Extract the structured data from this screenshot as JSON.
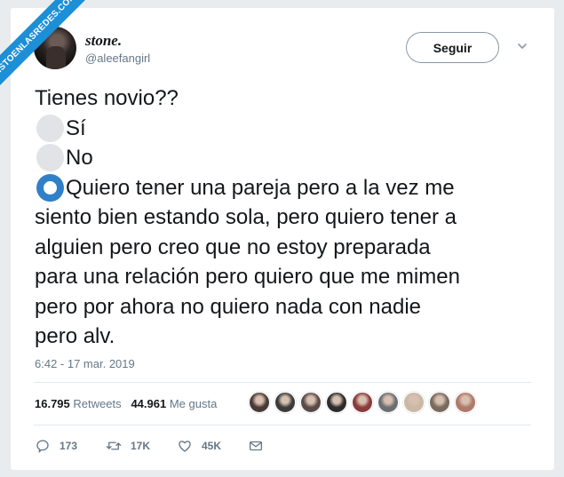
{
  "watermark": {
    "text": "VISTOENLASREDES.COM"
  },
  "tweet": {
    "display_name": "stone.",
    "handle": "@aleefangirl",
    "follow_label": "Seguir",
    "question": "Tienes novio??",
    "options": [
      {
        "label": "Sí",
        "selected": false
      },
      {
        "label": "No",
        "selected": false
      }
    ],
    "selected_option_lines": [
      "Quiero tener una pareja pero a la vez me",
      "siento bien estando sola, pero quiero tener a",
      "alguien pero creo que no estoy preparada",
      "para una relación pero quiero que me mimen",
      "pero por ahora no quiero nada con nadie",
      "pero alv."
    ],
    "timestamp": "6:42 - 17 mar. 2019"
  },
  "stats": {
    "retweets_count": "16.795",
    "retweets_label": "Retweets",
    "likes_count": "44.961",
    "likes_label": "Me gusta",
    "liker_avatar_colors": [
      "#4a3a36",
      "#3b3b3b",
      "#5a4a48",
      "#2c2c2c",
      "#8a3b3b",
      "#6b6f73",
      "#c9b9a4",
      "#7a6a5e",
      "#b07a6a"
    ]
  },
  "actions": {
    "reply_count": "173",
    "retweet_count": "17K",
    "like_count": "45K",
    "icons": [
      "reply-icon",
      "retweet-icon",
      "heart-icon",
      "mail-icon"
    ]
  },
  "colors": {
    "accent": "#2f80c8",
    "muted": "#657786",
    "ribbon": "#1d8fd6"
  }
}
